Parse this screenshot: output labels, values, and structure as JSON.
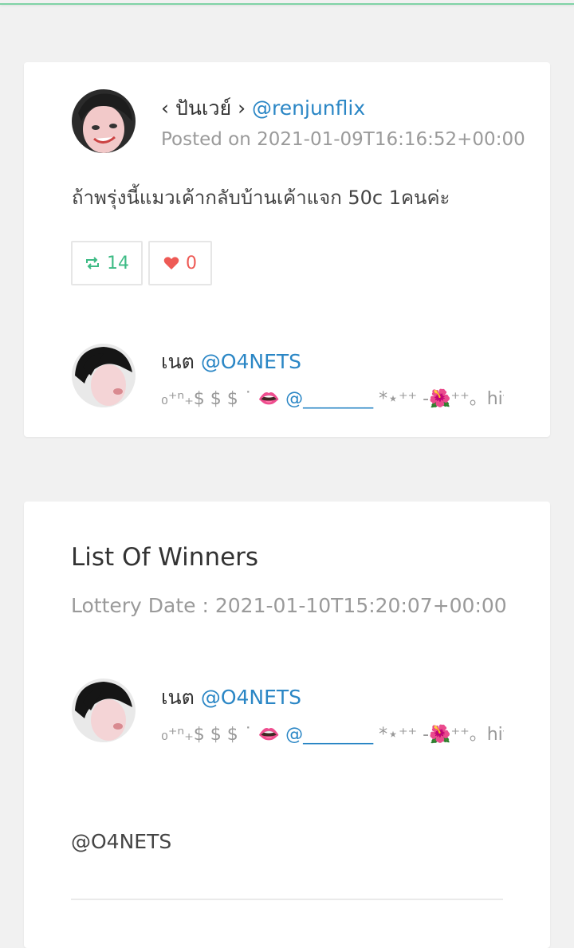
{
  "tweet": {
    "author_display": "‹ ปันเวย์ ›",
    "author_handle": "@renjunflix",
    "posted": "Posted on 2021-01-09T16:16:52+00:00",
    "text": "ถ้าพรุ่งนี้แมวเค้ากลับบ้านเค้าแจก 50c 1คนค่ะ",
    "retweet_count": "14",
    "like_count": "0",
    "icons": {
      "retweet": "retweet-icon",
      "like": "heart-icon"
    }
  },
  "commenter": {
    "display": "เนต",
    "handle": "@O4NETS",
    "bio_prefix": "₀⁺ⁿ₊$ $ $ ˙ 👄",
    "bio_mention": "@________",
    "bio_suffix": "*⋆⁺⁺ -🌺⁺⁺。hit ..."
  },
  "winners": {
    "title": "List Of Winners",
    "lottery_date": "Lottery Date : 2021-01-10T15:20:07+00:00",
    "winner": {
      "display": "เนต",
      "handle": "@O4NETS",
      "bio_prefix": "₀⁺ⁿ₊$ $ $ ˙ 👄",
      "bio_mention": "@________",
      "bio_suffix": "*⋆⁺⁺ -🌺⁺⁺。hit ..."
    },
    "winner_handle_text": "@O4NETS"
  },
  "colors": {
    "link": "#2a86c5",
    "retweet": "#3dbb85",
    "like": "#ee5a55",
    "muted": "#9a9a9a",
    "background": "#f1f1f1"
  }
}
